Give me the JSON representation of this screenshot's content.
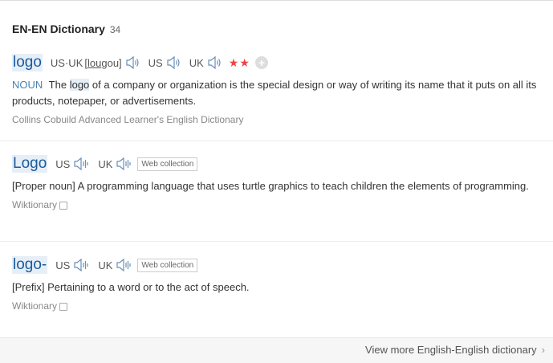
{
  "header": {
    "title": "EN-EN Dictionary",
    "count": "34"
  },
  "entries": [
    {
      "word": "logo",
      "pron_label_1": "US·UK",
      "phonetic_open": "[",
      "phonetic_ul": "lou",
      "phonetic_rest": "gou]",
      "us_label": "US",
      "uk_label": "UK",
      "stars": "★★",
      "plus": "+",
      "pos": "NOUN",
      "def_before": "The",
      "def_highlight": "logo",
      "def_after": "of a company or organization is the special design or way of writing its name that it puts on all its products, notepaper, or advertisements.",
      "source": "Collins Cobuild Advanced Learner's English Dictionary"
    },
    {
      "word": "Logo",
      "us_label": "US",
      "uk_label": "UK",
      "badge": "Web collection",
      "definition": "[Proper noun] A programming language that uses turtle graphics to teach children the elements of programming.",
      "source": "Wiktionary"
    },
    {
      "word": "logo-",
      "us_label": "US",
      "uk_label": "UK",
      "badge": "Web collection",
      "definition": "[Prefix] Pertaining to a word or to the act of speech.",
      "source": "Wiktionary"
    }
  ],
  "footer": {
    "more_label": "View more English-English dictionary",
    "chevron": "›"
  }
}
